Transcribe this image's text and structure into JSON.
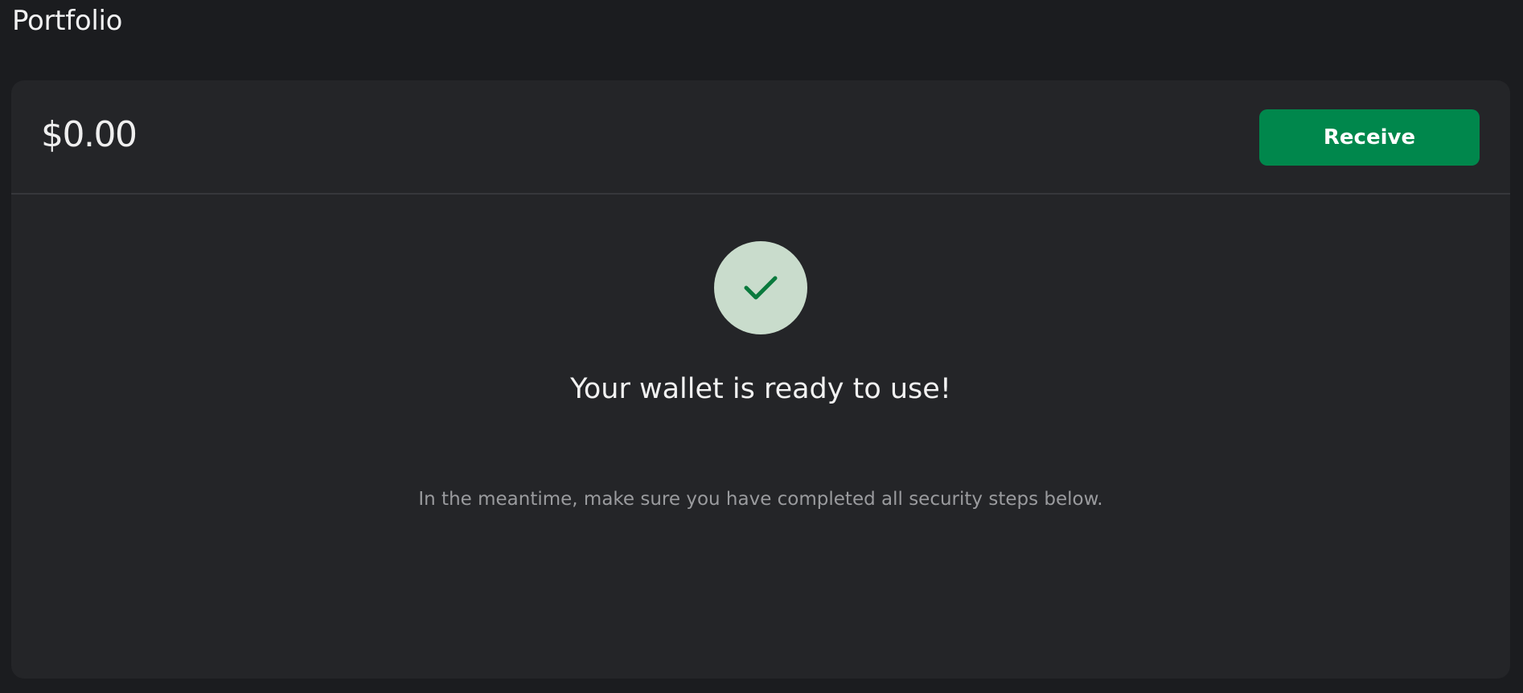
{
  "header": {
    "title": "Portfolio"
  },
  "portfolio": {
    "balance": "$0.00",
    "receive_label": "Receive"
  },
  "status": {
    "icon": "checkmark-icon",
    "title": "Your wallet is ready to use!",
    "subtitle": "In the meantime, make sure you have completed all security steps below."
  },
  "colors": {
    "background": "#1b1c1f",
    "card": "#242528",
    "accent": "#00874c",
    "success_circle": "#c9dccc",
    "success_check": "#0a7a3d"
  }
}
